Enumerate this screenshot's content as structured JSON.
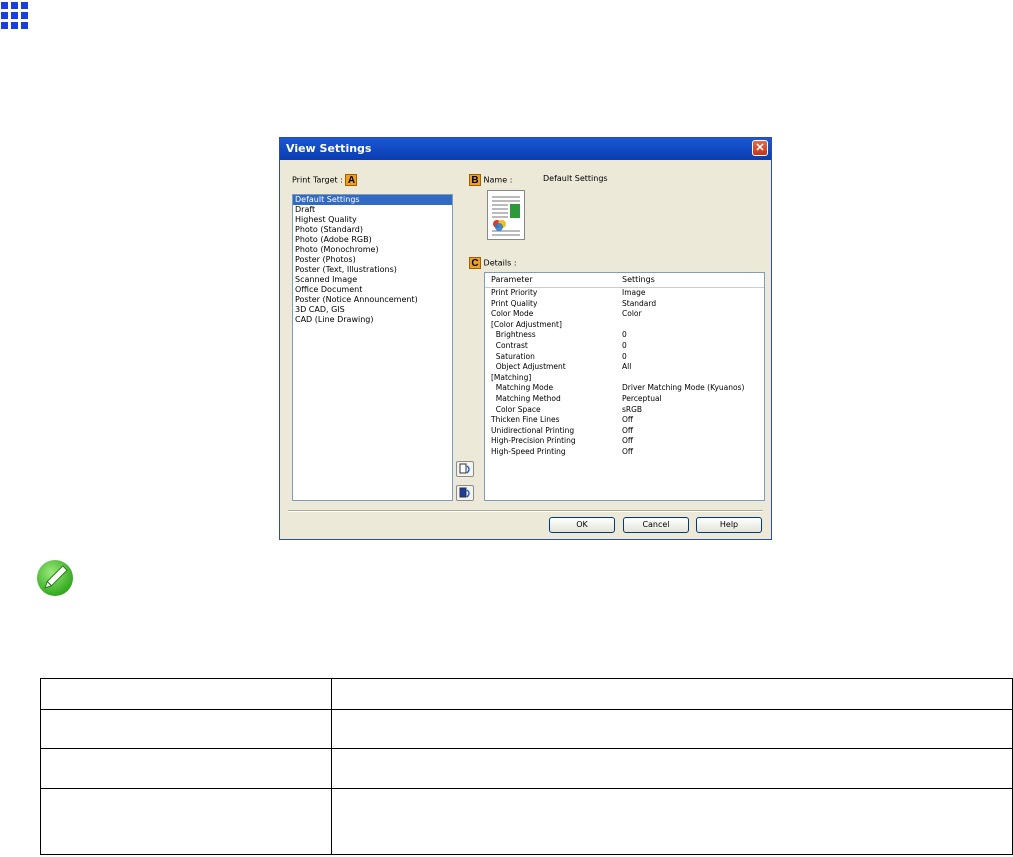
{
  "icons": {
    "grid": "grid-icon",
    "note": "pencil-note-icon",
    "close": "close-icon",
    "preview": "document-preview-icon",
    "add": "add-settings-icon",
    "edit": "edit-settings-icon"
  },
  "dialog": {
    "title": "View Settings",
    "close_glyph": "✕",
    "print_target": {
      "label": "Print Target :",
      "badge": "A"
    },
    "name": {
      "badge": "B",
      "label": "Name :",
      "value": "Default Settings"
    },
    "details": {
      "badge": "C",
      "label": "Details :",
      "col_parameter": "Parameter",
      "col_settings": "Settings",
      "rows": [
        {
          "p": "Print Priority",
          "v": "Image"
        },
        {
          "p": "Print Quality",
          "v": "Standard"
        },
        {
          "p": "Color Mode",
          "v": "Color"
        },
        {
          "p": "[Color Adjustment]",
          "v": ""
        },
        {
          "p": "  Brightness",
          "v": "0"
        },
        {
          "p": "  Contrast",
          "v": "0"
        },
        {
          "p": "  Saturation",
          "v": "0"
        },
        {
          "p": "  Object Adjustment",
          "v": "All"
        },
        {
          "p": "[Matching]",
          "v": ""
        },
        {
          "p": "  Matching Mode",
          "v": "Driver Matching Mode (Kyuanos)"
        },
        {
          "p": "  Matching Method",
          "v": "Perceptual"
        },
        {
          "p": "  Color Space",
          "v": "sRGB"
        },
        {
          "p": "Thicken Fine Lines",
          "v": "Off"
        },
        {
          "p": "Unidirectional Printing",
          "v": "Off"
        },
        {
          "p": "High-Precision Printing",
          "v": "Off"
        },
        {
          "p": "High-Speed Printing",
          "v": "Off"
        }
      ]
    },
    "print_targets": [
      "Default Settings",
      "Draft",
      "Highest Quality",
      "Photo (Standard)",
      "Photo (Adobe RGB)",
      "Photo (Monochrome)",
      "Poster (Photos)",
      "Poster (Text, Illustrations)",
      "Scanned Image",
      "Office Document",
      "Poster (Notice Announcement)",
      "3D CAD, GIS",
      "CAD (Line Drawing)"
    ],
    "selected_index": 0,
    "buttons": {
      "ok": "OK",
      "cancel": "Cancel",
      "help": "Help"
    }
  },
  "table": {
    "rows": [
      [
        "",
        ""
      ],
      [
        "",
        ""
      ],
      [
        "",
        ""
      ],
      [
        "",
        ""
      ]
    ]
  }
}
